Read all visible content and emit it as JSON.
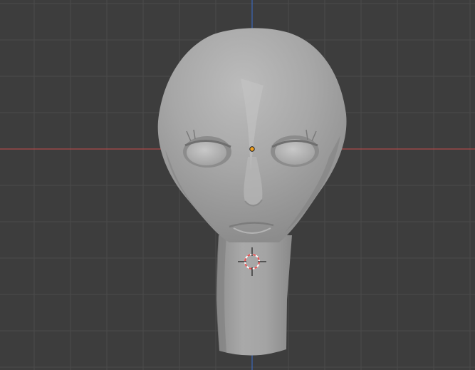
{
  "app": {
    "view": "3d-viewport",
    "object": "alien-head-mesh",
    "shading": "solid"
  },
  "viewport": {
    "background_color": "#3d3d3d",
    "grid_color": "#4a4a4a",
    "x_axis_color": "#c84a4a",
    "z_axis_color": "#3a6ecf",
    "origin_dot_color": "#f2a01e",
    "cursor_colors": [
      "#e85050",
      "#ffffff"
    ]
  },
  "icons": {
    "origin": "object-origin-icon",
    "cursor": "3d-cursor-icon"
  }
}
